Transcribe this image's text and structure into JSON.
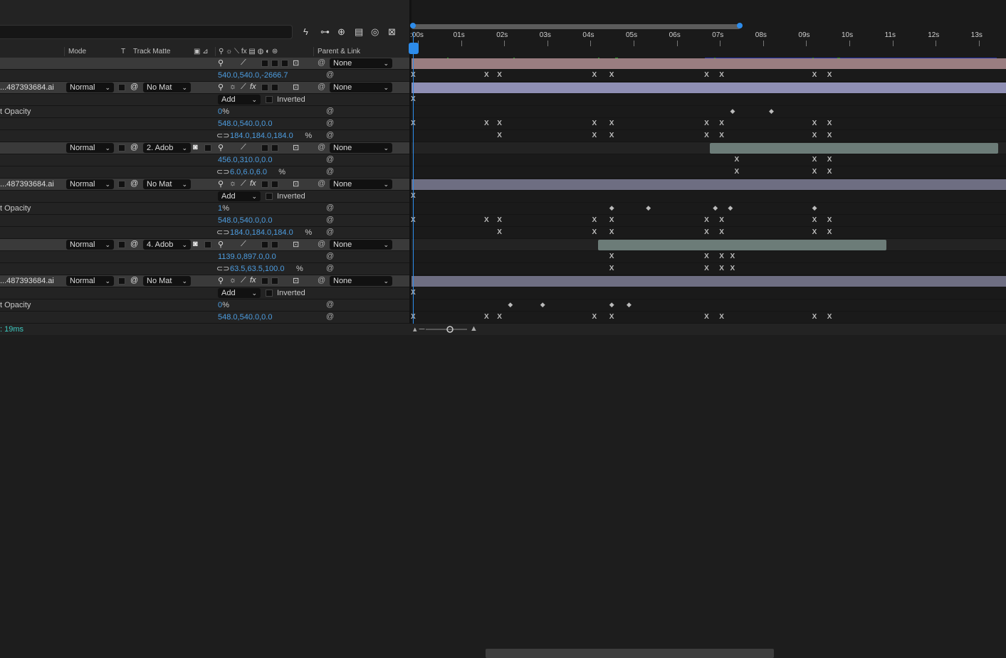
{
  "toolbar": {
    "icons": [
      "graph-icon",
      "draft-3d-icon",
      "motion-blur-icon",
      "frame-blending-icon",
      "shy-icon",
      "render-icon"
    ]
  },
  "headers": {
    "mode": "Mode",
    "t": "T",
    "track_matte": "Track Matte",
    "parent_link": "Parent & Link"
  },
  "ruler": {
    "labels": [
      ":00s",
      "01s",
      "02s",
      "03s",
      "04s",
      "05s",
      "06s",
      "07s",
      "08s",
      "09s",
      "10s",
      "11s",
      "12s",
      "13s"
    ]
  },
  "rows": [
    {
      "type": "layer",
      "name": "",
      "parent": "None"
    },
    {
      "type": "prop",
      "label": "",
      "value": "540.0,540.0,-2666.7"
    },
    {
      "type": "layer",
      "name": "...487393684.ai",
      "mode": "Normal",
      "matte": "No Mat",
      "parent": "None"
    },
    {
      "type": "mask",
      "mode": "Add",
      "inverted": "Inverted"
    },
    {
      "type": "prop",
      "label": "t Opacity",
      "value": "0",
      "unit": "%"
    },
    {
      "type": "prop",
      "label": "",
      "value": "548.0,540.0,0.0"
    },
    {
      "type": "prop",
      "label": "",
      "value": "184.0,184.0,184.0",
      "unit": "%",
      "linked": true
    },
    {
      "type": "layer",
      "name": "",
      "mode": "Normal",
      "matte": "2. Adob",
      "parent": "None"
    },
    {
      "type": "prop",
      "label": "",
      "value": "456.0,310.0,0.0"
    },
    {
      "type": "prop",
      "label": "",
      "value": "6.0,6.0,6.0",
      "unit": "%",
      "linked": true
    },
    {
      "type": "layer",
      "name": "...487393684.ai",
      "mode": "Normal",
      "matte": "No Mat",
      "parent": "None"
    },
    {
      "type": "mask",
      "mode": "Add",
      "inverted": "Inverted"
    },
    {
      "type": "prop",
      "label": "t Opacity",
      "value": "1",
      "unit": "%"
    },
    {
      "type": "prop",
      "label": "",
      "value": "548.0,540.0,0.0"
    },
    {
      "type": "prop",
      "label": "",
      "value": "184.0,184.0,184.0",
      "unit": "%",
      "linked": true
    },
    {
      "type": "layer",
      "name": "",
      "mode": "Normal",
      "matte": "4. Adob",
      "parent": "None"
    },
    {
      "type": "prop",
      "label": "",
      "value": "1139.0,897.0,0.0"
    },
    {
      "type": "prop",
      "label": "",
      "value": "63.5,63.5,100.0",
      "unit": "%",
      "linked": true
    },
    {
      "type": "layer",
      "name": "...487393684.ai",
      "mode": "Normal",
      "matte": "No Mat",
      "parent": "None"
    },
    {
      "type": "mask",
      "mode": "Add",
      "inverted": "Inverted"
    },
    {
      "type": "prop",
      "label": "t Opacity",
      "value": "0",
      "unit": "%"
    },
    {
      "type": "prop",
      "label": "",
      "value": "548.0,540.0,0.0"
    }
  ],
  "status": {
    "render_time": ": 19ms"
  },
  "colors": {
    "accent": "#2d8ceb",
    "value": "#4d9de0",
    "bar_pink": "#9a7d80",
    "bar_lavender": "#8f8fb4",
    "bar_gray": "#6e6e82",
    "bar_green": "#6c7c78"
  }
}
